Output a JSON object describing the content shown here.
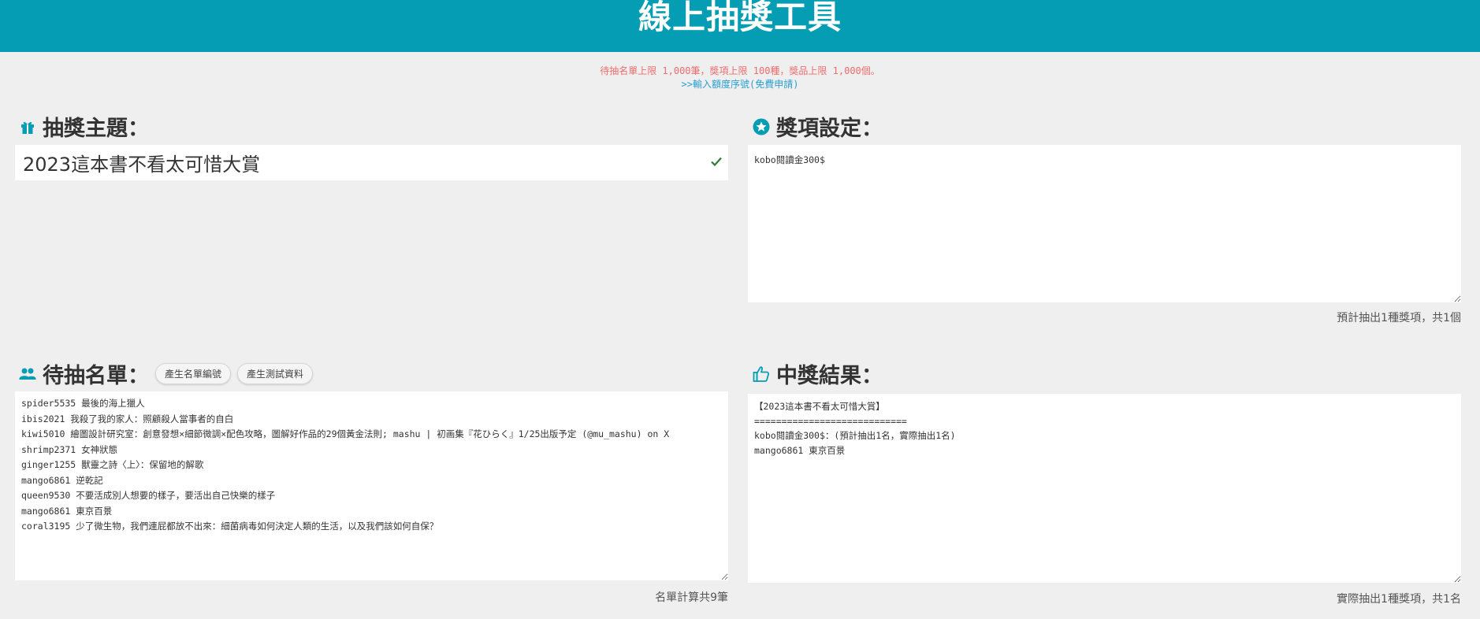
{
  "header": {
    "title": "線上抽獎工具"
  },
  "notice": {
    "limits": "待抽名單上限 1,000筆，獎項上限 100種，獎品上限 1,000個。",
    "quota_link": ">>輸入額度序號(免費申請)"
  },
  "theme": {
    "title": "抽獎主題：",
    "value": "2023這本書不看太可惜大賞"
  },
  "prizes": {
    "title": "獎項設定：",
    "content": "kobo閱讀金300$",
    "summary": "預計抽出1種獎項，共1個"
  },
  "entrants": {
    "title": "待抽名單：",
    "btn_serial": "產生名單編號",
    "btn_test": "產生測試資料",
    "content": "spider5535 最後的海上獵人\nibis2021 我殺了我的家人：照顧殺人當事者的自白\nkiwi5010 繪圖設計研究室：創意發想×細節微調×配色攻略，圖解好作品的29個黃金法則; mashu | 初画集『花ひらく』1/25出版予定 (@mu_mashu) on X\nshrimp2371 女神狀態\nginger1255 獸靈之詩〈上〉：保留地的解歌\nmango6861 逆乾記\nqueen9530 不要活成別人想要的樣子，要活出自己快樂的樣子\nmango6861 東京百景\ncoral3195 少了微生物，我們連屁都放不出來：細菌病毒如何決定人類的生活，以及我們該如何自保？",
    "summary": "名單計算共9筆"
  },
  "results": {
    "title": "中獎結果：",
    "content": "【2023這本書不看太可惜大賞】\n============================\nkobo閱讀金300$：(預計抽出1名，實際抽出1名)\nmango6861 東京百景",
    "summary": "實際抽出1種獎項，共1名"
  },
  "colors": {
    "brand": "#059db3",
    "notice_red": "#ec6d6d",
    "link_blue": "#2a9fd0",
    "check_green": "#2e7d32"
  }
}
